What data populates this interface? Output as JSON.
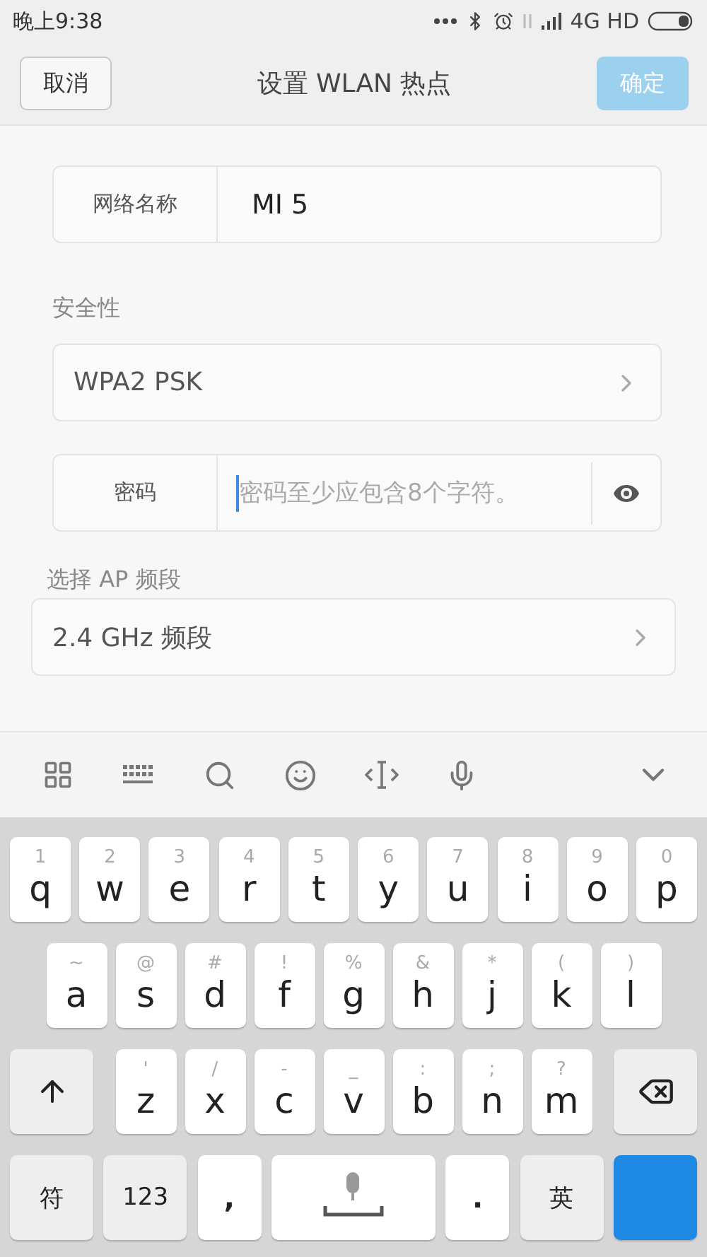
{
  "status_bar": {
    "time": "晚上9:38",
    "network": "4G HD"
  },
  "header": {
    "cancel": "取消",
    "title": "设置 WLAN 热点",
    "confirm": "确定",
    "confirm_disabled": true
  },
  "network_name": {
    "label": "网络名称",
    "value": "MI 5"
  },
  "security": {
    "label": "安全性",
    "value": "WPA2 PSK"
  },
  "password": {
    "label": "密码",
    "placeholder": "密码至少应包含8个字符。"
  },
  "band": {
    "label": "选择 AP 频段",
    "value": "2.4 GHz 频段"
  },
  "keyboard": {
    "rows": [
      {
        "keys": [
          {
            "kind": "letter",
            "label": "q",
            "hint": "1"
          },
          {
            "kind": "letter",
            "label": "w",
            "hint": "2"
          },
          {
            "kind": "letter",
            "label": "e",
            "hint": "3"
          },
          {
            "kind": "letter",
            "label": "r",
            "hint": "4"
          },
          {
            "kind": "letter",
            "label": "t",
            "hint": "5"
          },
          {
            "kind": "letter",
            "label": "y",
            "hint": "6"
          },
          {
            "kind": "letter",
            "label": "u",
            "hint": "7"
          },
          {
            "kind": "letter",
            "label": "i",
            "hint": "8"
          },
          {
            "kind": "letter",
            "label": "o",
            "hint": "9"
          },
          {
            "kind": "letter",
            "label": "p",
            "hint": "0"
          }
        ]
      },
      {
        "keys": [
          {
            "kind": "letter",
            "label": "a",
            "hint": "~"
          },
          {
            "kind": "letter",
            "label": "s",
            "hint": "@"
          },
          {
            "kind": "letter",
            "label": "d",
            "hint": "#"
          },
          {
            "kind": "letter",
            "label": "f",
            "hint": "!"
          },
          {
            "kind": "letter",
            "label": "g",
            "hint": "%"
          },
          {
            "kind": "letter",
            "label": "h",
            "hint": "&"
          },
          {
            "kind": "letter",
            "label": "j",
            "hint": "*"
          },
          {
            "kind": "letter",
            "label": "k",
            "hint": "("
          },
          {
            "kind": "letter",
            "label": "l",
            "hint": ")"
          }
        ]
      },
      {
        "keys": [
          {
            "kind": "shift"
          },
          {
            "kind": "letter",
            "label": "z",
            "hint": "'"
          },
          {
            "kind": "letter",
            "label": "x",
            "hint": "/"
          },
          {
            "kind": "letter",
            "label": "c",
            "hint": "-"
          },
          {
            "kind": "letter",
            "label": "v",
            "hint": "_"
          },
          {
            "kind": "letter",
            "label": "b",
            "hint": ":"
          },
          {
            "kind": "letter",
            "label": "n",
            "hint": ";"
          },
          {
            "kind": "letter",
            "label": "m",
            "hint": "?"
          },
          {
            "kind": "backspace"
          }
        ]
      },
      {
        "keys": [
          {
            "kind": "function",
            "label": "符"
          },
          {
            "kind": "function",
            "label": "123"
          },
          {
            "kind": "punct",
            "label": ","
          },
          {
            "kind": "space"
          },
          {
            "kind": "punct",
            "label": "."
          },
          {
            "kind": "function",
            "label": "英"
          },
          {
            "kind": "enter"
          }
        ]
      }
    ]
  }
}
